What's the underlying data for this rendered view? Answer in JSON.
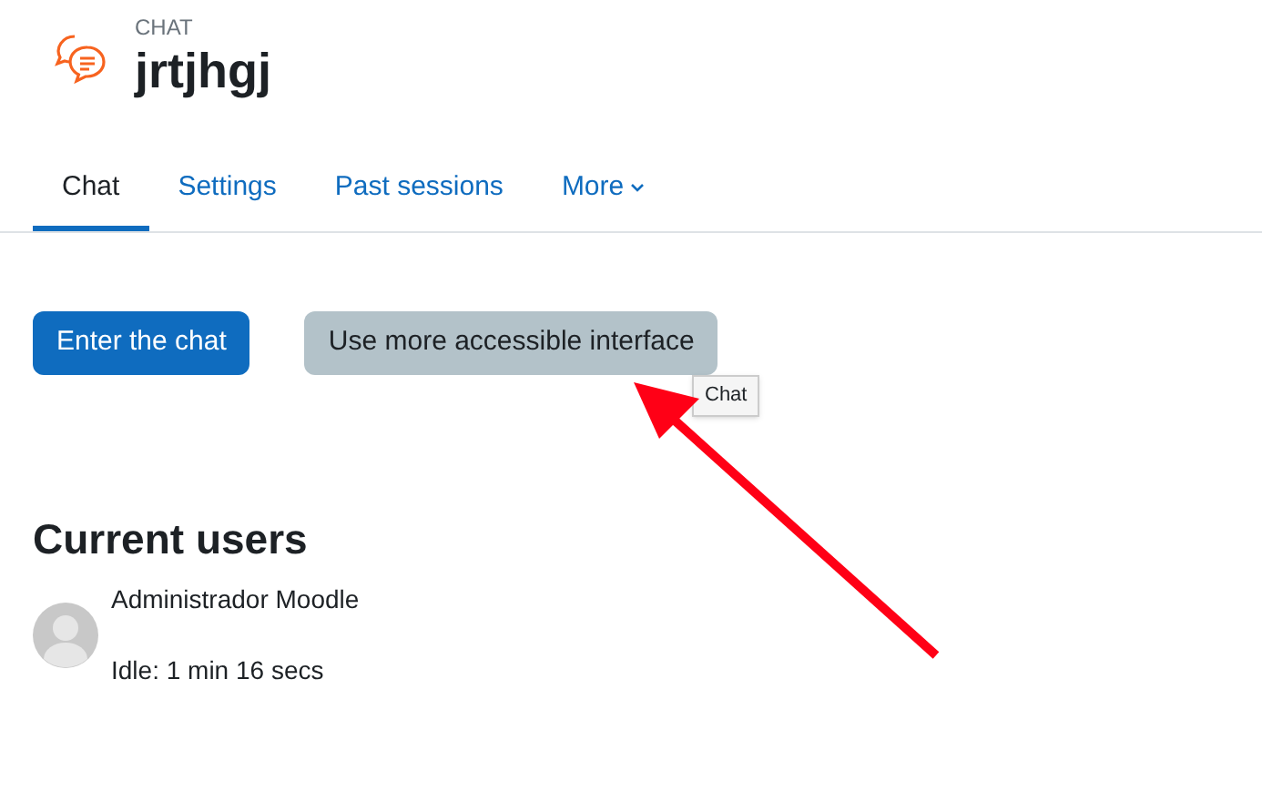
{
  "header": {
    "kicker": "CHAT",
    "title": "jrtjhgj"
  },
  "tabs": [
    {
      "label": "Chat",
      "selected": true
    },
    {
      "label": "Settings",
      "selected": false
    },
    {
      "label": "Past sessions",
      "selected": false
    },
    {
      "label": "More",
      "selected": false,
      "kind": "dropdown"
    }
  ],
  "buttons": [
    {
      "label": "Enter the chat",
      "kind": "primary"
    },
    {
      "label": "Use more accessible interface",
      "kind": "secondary"
    }
  ],
  "tooltip": "Chat",
  "current_users": {
    "heading": "Current users",
    "users": [
      {
        "name": "Administrador Moodle",
        "status": "Idle: 1 min 16 secs"
      }
    ]
  }
}
